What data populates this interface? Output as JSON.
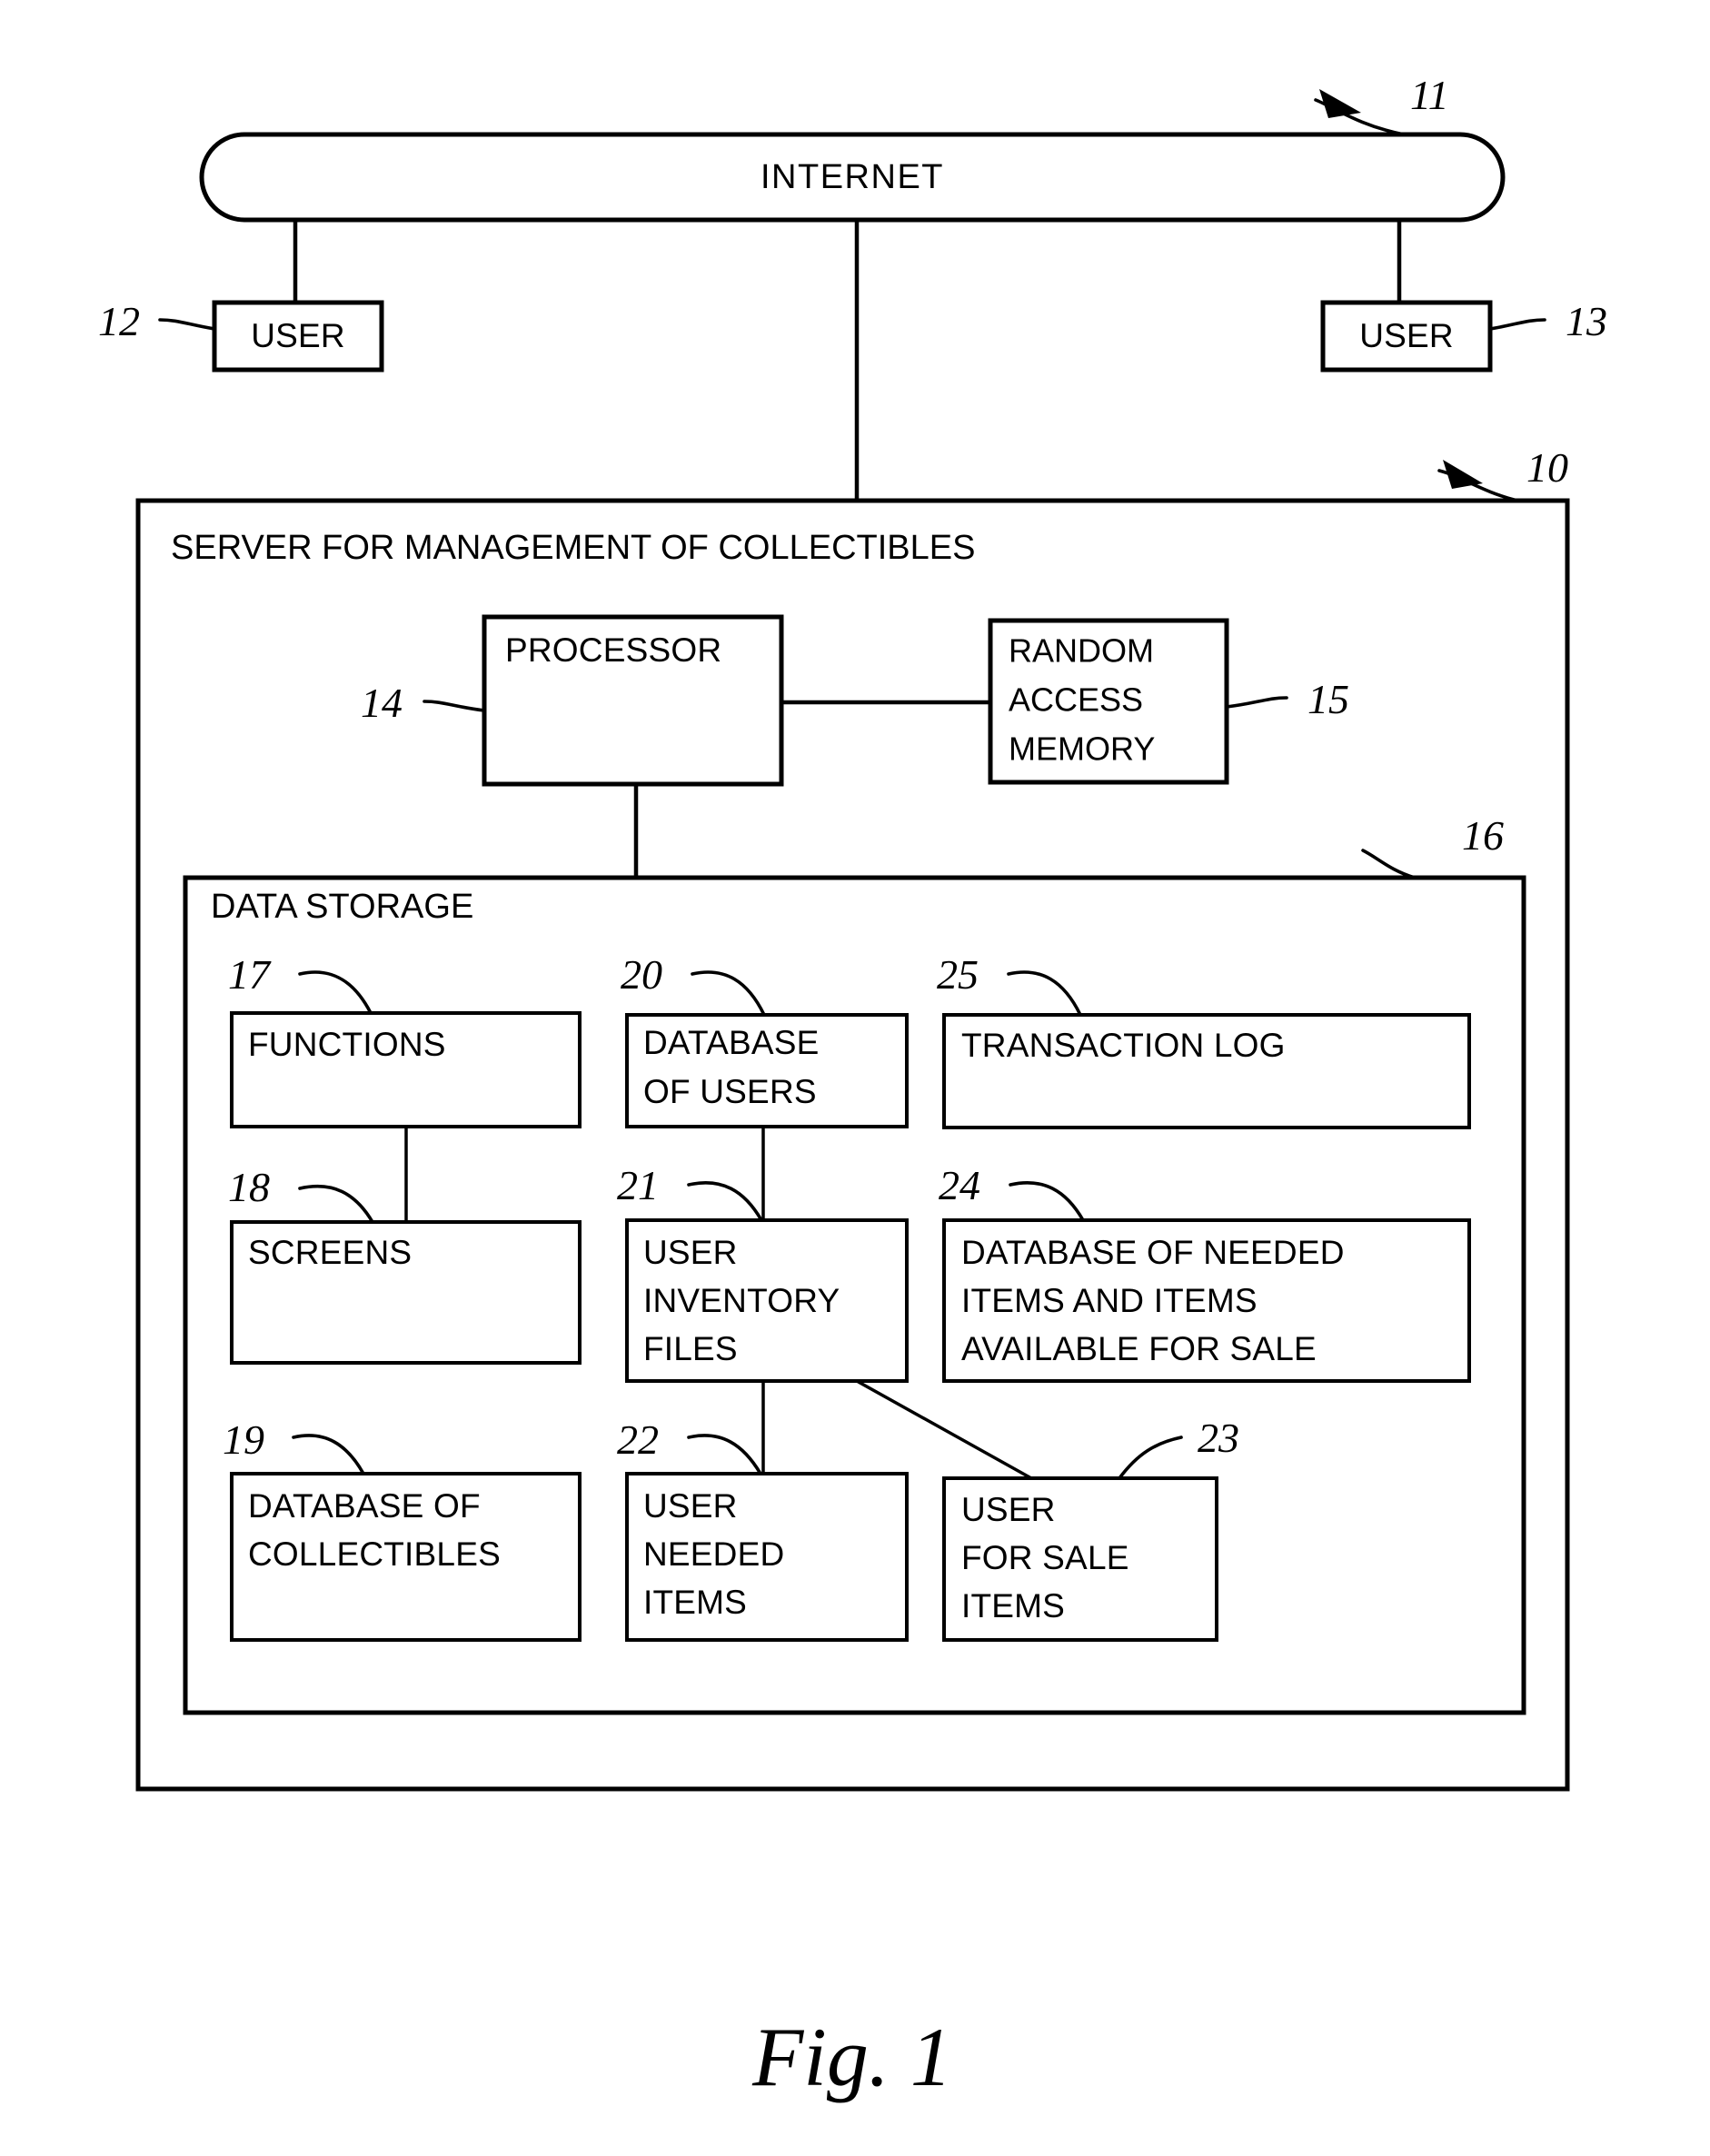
{
  "figure": {
    "caption": "Fig.  1"
  },
  "network": {
    "internet_label": "INTERNET",
    "internet_ref": "11",
    "user_left_label": "USER",
    "user_left_ref": "12",
    "user_right_label": "USER",
    "user_right_ref": "13"
  },
  "server": {
    "title": "SERVER FOR MANAGEMENT OF COLLECTIBLES",
    "ref": "10",
    "processor": {
      "label": "PROCESSOR",
      "ref": "14"
    },
    "ram": {
      "line1": "RANDOM",
      "line2": "ACCESS",
      "line3": "MEMORY",
      "ref": "15"
    }
  },
  "data_storage": {
    "title": "DATA STORAGE",
    "ref": "16",
    "boxes": [
      {
        "id": "functions",
        "ref": "17",
        "lines": [
          "FUNCTIONS"
        ]
      },
      {
        "id": "screens",
        "ref": "18",
        "lines": [
          "SCREENS"
        ]
      },
      {
        "id": "database-of-collectibles",
        "ref": "19",
        "lines": [
          "DATABASE OF",
          "COLLECTIBLES"
        ]
      },
      {
        "id": "database-of-users",
        "ref": "20",
        "lines": [
          "DATABASE",
          "OF USERS"
        ]
      },
      {
        "id": "user-inventory-files",
        "ref": "21",
        "lines": [
          "USER",
          "INVENTORY",
          "FILES"
        ]
      },
      {
        "id": "user-needed-items",
        "ref": "22",
        "lines": [
          "USER",
          "NEEDED",
          "ITEMS"
        ]
      },
      {
        "id": "user-for-sale-items",
        "ref": "23",
        "lines": [
          "USER",
          "FOR SALE",
          "ITEMS"
        ]
      },
      {
        "id": "database-of-needed-items",
        "ref": "24",
        "lines": [
          "DATABASE OF NEEDED",
          "ITEMS AND ITEMS",
          "AVAILABLE FOR SALE"
        ]
      },
      {
        "id": "transaction-log",
        "ref": "25",
        "lines": [
          "TRANSACTION LOG"
        ]
      }
    ]
  },
  "colors": {
    "ink": "#000000",
    "paper": "#ffffff"
  }
}
